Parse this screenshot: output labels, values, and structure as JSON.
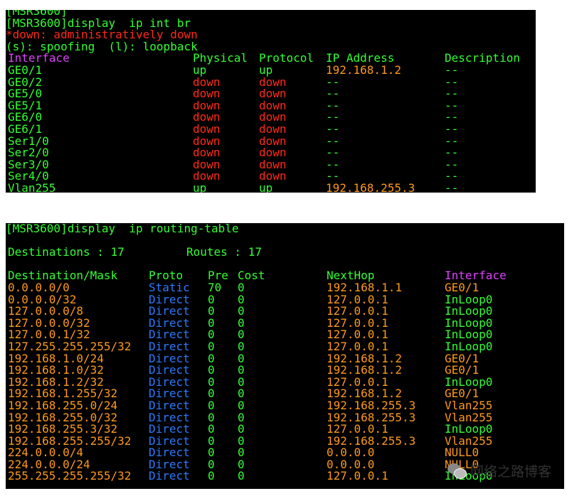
{
  "terminal1": {
    "partial_top_line": "[MSR3600]",
    "command": "[MSR3600]display  ip int br",
    "legend_down": "*down: administratively down",
    "legend_spoof": "(s): spoofing  (l): loopback",
    "headers": [
      "Interface",
      "Physical",
      "Protocol",
      "IP Address",
      "Description"
    ],
    "rows": [
      {
        "iface": "GE0/1",
        "phys": "up",
        "proto": "up",
        "ip": "192.168.1.2",
        "desc": "--"
      },
      {
        "iface": "GE0/2",
        "phys": "down",
        "proto": "down",
        "ip": "--",
        "desc": "--"
      },
      {
        "iface": "GE5/0",
        "phys": "down",
        "proto": "down",
        "ip": "--",
        "desc": "--"
      },
      {
        "iface": "GE5/1",
        "phys": "down",
        "proto": "down",
        "ip": "--",
        "desc": "--"
      },
      {
        "iface": "GE6/0",
        "phys": "down",
        "proto": "down",
        "ip": "--",
        "desc": "--"
      },
      {
        "iface": "GE6/1",
        "phys": "down",
        "proto": "down",
        "ip": "--",
        "desc": "--"
      },
      {
        "iface": "Ser1/0",
        "phys": "down",
        "proto": "down",
        "ip": "--",
        "desc": "--"
      },
      {
        "iface": "Ser2/0",
        "phys": "down",
        "proto": "down",
        "ip": "--",
        "desc": "--"
      },
      {
        "iface": "Ser3/0",
        "phys": "down",
        "proto": "down",
        "ip": "--",
        "desc": "--"
      },
      {
        "iface": "Ser4/0",
        "phys": "down",
        "proto": "down",
        "ip": "--",
        "desc": "--"
      },
      {
        "iface": "Vlan255",
        "phys": "up",
        "proto": "up",
        "ip": "192.168.255.3",
        "desc": "--"
      }
    ]
  },
  "terminal2": {
    "command": "[MSR3600]display  ip routing-table",
    "destinations_label": "Destinations : 17",
    "routes_label": "Routes : 17",
    "headers": [
      "Destination/Mask",
      "Proto",
      "Pre",
      "Cost",
      "NextHop",
      "Interface"
    ],
    "rows": [
      {
        "dest": "0.0.0.0/0",
        "proto": "Static",
        "pre": "70",
        "cost": "0",
        "nexthop": "192.168.1.1",
        "iface": "GE0/1"
      },
      {
        "dest": "0.0.0.0/32",
        "proto": "Direct",
        "pre": "0",
        "cost": "0",
        "nexthop": "127.0.0.1",
        "iface": "InLoop0"
      },
      {
        "dest": "127.0.0.0/8",
        "proto": "Direct",
        "pre": "0",
        "cost": "0",
        "nexthop": "127.0.0.1",
        "iface": "InLoop0"
      },
      {
        "dest": "127.0.0.0/32",
        "proto": "Direct",
        "pre": "0",
        "cost": "0",
        "nexthop": "127.0.0.1",
        "iface": "InLoop0"
      },
      {
        "dest": "127.0.0.1/32",
        "proto": "Direct",
        "pre": "0",
        "cost": "0",
        "nexthop": "127.0.0.1",
        "iface": "InLoop0"
      },
      {
        "dest": "127.255.255.255/32",
        "proto": "Direct",
        "pre": "0",
        "cost": "0",
        "nexthop": "127.0.0.1",
        "iface": "InLoop0"
      },
      {
        "dest": "192.168.1.0/24",
        "proto": "Direct",
        "pre": "0",
        "cost": "0",
        "nexthop": "192.168.1.2",
        "iface": "GE0/1"
      },
      {
        "dest": "192.168.1.0/32",
        "proto": "Direct",
        "pre": "0",
        "cost": "0",
        "nexthop": "192.168.1.2",
        "iface": "GE0/1"
      },
      {
        "dest": "192.168.1.2/32",
        "proto": "Direct",
        "pre": "0",
        "cost": "0",
        "nexthop": "127.0.0.1",
        "iface": "InLoop0"
      },
      {
        "dest": "192.168.1.255/32",
        "proto": "Direct",
        "pre": "0",
        "cost": "0",
        "nexthop": "192.168.1.2",
        "iface": "GE0/1"
      },
      {
        "dest": "192.168.255.0/24",
        "proto": "Direct",
        "pre": "0",
        "cost": "0",
        "nexthop": "192.168.255.3",
        "iface": "Vlan255"
      },
      {
        "dest": "192.168.255.0/32",
        "proto": "Direct",
        "pre": "0",
        "cost": "0",
        "nexthop": "192.168.255.3",
        "iface": "Vlan255"
      },
      {
        "dest": "192.168.255.3/32",
        "proto": "Direct",
        "pre": "0",
        "cost": "0",
        "nexthop": "127.0.0.1",
        "iface": "InLoop0"
      },
      {
        "dest": "192.168.255.255/32",
        "proto": "Direct",
        "pre": "0",
        "cost": "0",
        "nexthop": "192.168.255.3",
        "iface": "Vlan255"
      },
      {
        "dest": "224.0.0.0/4",
        "proto": "Direct",
        "pre": "0",
        "cost": "0",
        "nexthop": "0.0.0.0",
        "iface": "NULL0"
      },
      {
        "dest": "224.0.0.0/24",
        "proto": "Direct",
        "pre": "0",
        "cost": "0",
        "nexthop": "0.0.0.0",
        "iface": "NULL0"
      },
      {
        "dest": "255.255.255.255/32",
        "proto": "Direct",
        "pre": "0",
        "cost": "0",
        "nexthop": "127.0.0.1",
        "iface": "InLoop0"
      }
    ]
  },
  "watermark": {
    "text": "网络之路博客",
    "icon": "wechat-icon"
  },
  "colors": {
    "background": "#000000",
    "green": "#33ff33",
    "red": "#ff2a1a",
    "orange": "#ff9a1a",
    "magenta": "#e040ff",
    "blue": "#2b7bff"
  }
}
